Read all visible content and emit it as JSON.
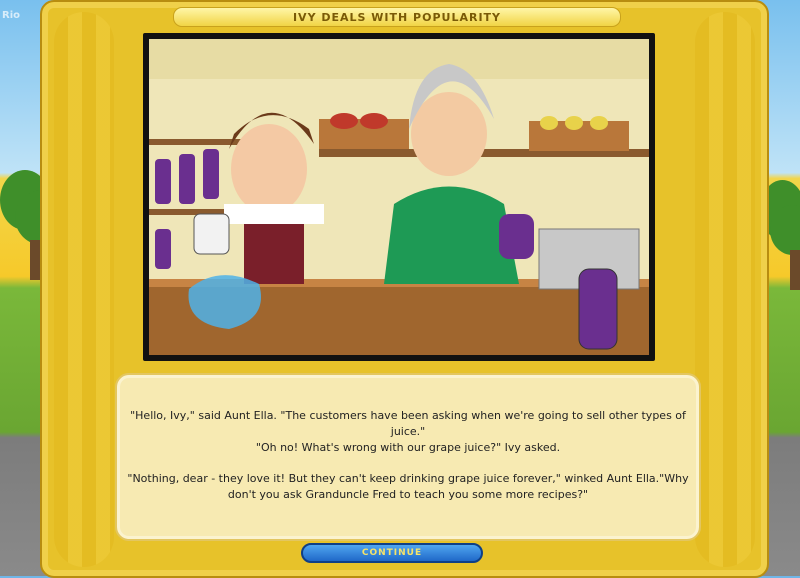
{
  "window": {
    "title": "Ivy Deals With Popularity"
  },
  "story": {
    "paragraphs": [
      "\"Hello, Ivy,\" said Aunt Ella. \"The customers have been asking when we're going to sell other types of juice.\"",
      "\"Oh no! What's wrong with our grape juice?\" Ivy asked.",
      "\"Nothing, dear - they love it! But they can't keep drinking grape juice forever,\" winked Aunt Ella.\"Why don't you ask Granduncle Fred to teach you some more recipes?\""
    ]
  },
  "buttons": {
    "continue_label": "Continue"
  },
  "watermark": "Rio",
  "colors": {
    "frame": "#e7c22a",
    "dialog_bg": "#f7eab2",
    "button_blue": "#1f68c8",
    "button_text": "#f5e36a",
    "title_text": "#7a5a06"
  }
}
